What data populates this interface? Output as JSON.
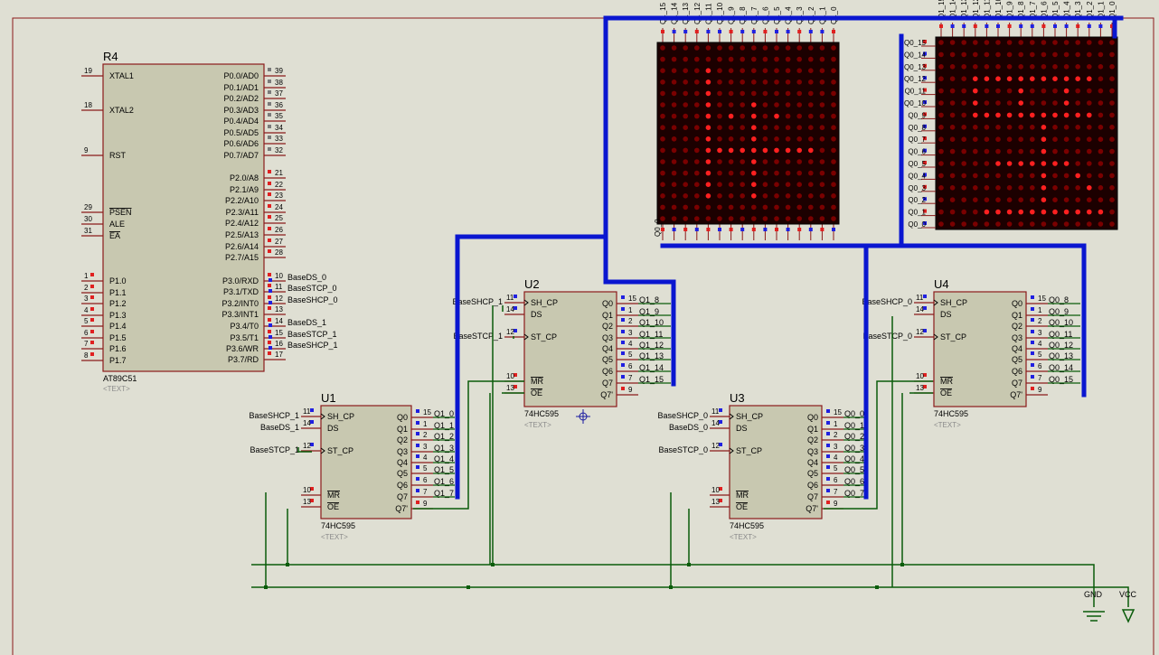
{
  "colors": {
    "background": "#dfdfd3",
    "chip_fill": "#c8c8b0",
    "chip_border": "#8b1a1a",
    "pin_line": "#8b1a1a",
    "wire": "#0a5c0a",
    "bus": "#0a16d0",
    "matrix_bg": "#1c0000",
    "led_on": "#ff2020",
    "led_off": "#7a0000",
    "text": "#000000",
    "placeholder": "#8a8a8a"
  },
  "mcu": {
    "ref": "R4",
    "part": "AT89C51",
    "placeholder": "<TEXT>",
    "left_pins": [
      {
        "num": "19",
        "name": "XTAL1"
      },
      {
        "num": "18",
        "name": "XTAL2"
      },
      {
        "num": "9",
        "name": "RST"
      },
      {
        "num": "29",
        "name": "PSEN"
      },
      {
        "num": "30",
        "name": "ALE"
      },
      {
        "num": "31",
        "name": "EA"
      },
      {
        "num": "1",
        "name": "P1.0"
      },
      {
        "num": "2",
        "name": "P1.1"
      },
      {
        "num": "3",
        "name": "P1.2"
      },
      {
        "num": "4",
        "name": "P1.3"
      },
      {
        "num": "5",
        "name": "P1.4"
      },
      {
        "num": "6",
        "name": "P1.5"
      },
      {
        "num": "7",
        "name": "P1.6"
      },
      {
        "num": "8",
        "name": "P1.7"
      }
    ],
    "right_pins": [
      {
        "num": "39",
        "name": "P0.0/AD0"
      },
      {
        "num": "38",
        "name": "P0.1/AD1"
      },
      {
        "num": "37",
        "name": "P0.2/AD2"
      },
      {
        "num": "36",
        "name": "P0.3/AD3"
      },
      {
        "num": "35",
        "name": "P0.4/AD4"
      },
      {
        "num": "34",
        "name": "P0.5/AD5"
      },
      {
        "num": "33",
        "name": "P0.6/AD6"
      },
      {
        "num": "32",
        "name": "P0.7/AD7"
      },
      {
        "num": "21",
        "name": "P2.0/A8"
      },
      {
        "num": "22",
        "name": "P2.1/A9"
      },
      {
        "num": "23",
        "name": "P2.2/A10"
      },
      {
        "num": "24",
        "name": "P2.3/A11"
      },
      {
        "num": "25",
        "name": "P2.4/A12"
      },
      {
        "num": "26",
        "name": "P2.5/A13"
      },
      {
        "num": "27",
        "name": "P2.6/A14"
      },
      {
        "num": "28",
        "name": "P2.7/A15"
      },
      {
        "num": "10",
        "name": "P3.0/RXD"
      },
      {
        "num": "11",
        "name": "P3.1/TXD"
      },
      {
        "num": "12",
        "name": "P3.2/INT0"
      },
      {
        "num": "13",
        "name": "P3.3/INT1"
      },
      {
        "num": "14",
        "name": "P3.4/T0"
      },
      {
        "num": "15",
        "name": "P3.5/T1"
      },
      {
        "num": "16",
        "name": "P3.6/WR"
      },
      {
        "num": "17",
        "name": "P3.7/RD"
      }
    ],
    "net_labels": [
      "BaseDS_0",
      "BaseSTCP_0",
      "BaseSHCP_0",
      "",
      "BaseDS_1",
      "BaseSTCP_1",
      "BaseSHCP_1",
      ""
    ]
  },
  "shift_register_pins": {
    "left": [
      {
        "num": "11",
        "name": "SH_CP"
      },
      {
        "num": "14",
        "name": "DS"
      },
      {
        "num": "12",
        "name": "ST_CP"
      },
      {
        "num": "10",
        "name": "MR"
      },
      {
        "num": "13",
        "name": "OE"
      }
    ],
    "right_names": [
      "Q0",
      "Q1",
      "Q2",
      "Q3",
      "Q4",
      "Q5",
      "Q6",
      "Q7",
      "Q7'"
    ],
    "right_nums": [
      "15",
      "1",
      "2",
      "3",
      "4",
      "5",
      "6",
      "7",
      "9"
    ]
  },
  "shift_registers": [
    {
      "ref": "U1",
      "part": "74HC595",
      "placeholder": "<TEXT>",
      "in_labels": [
        "BaseSHCP_1",
        "BaseDS_1",
        "BaseSTCP_1"
      ],
      "out_labels": [
        "Q1_0",
        "Q1_1",
        "Q1_2",
        "Q1_3",
        "Q1_4",
        "Q1_5",
        "Q1_6",
        "Q1_7"
      ]
    },
    {
      "ref": "U2",
      "part": "74HC595",
      "placeholder": "<TEXT>",
      "in_labels": [
        "BaseSHCP_1",
        "",
        "BaseSTCP_1"
      ],
      "out_labels": [
        "Q1_8",
        "Q1_9",
        "Q1_10",
        "Q1_11",
        "Q1_12",
        "Q1_13",
        "Q1_14",
        "Q1_15"
      ]
    },
    {
      "ref": "U3",
      "part": "74HC595",
      "placeholder": "<TEXT>",
      "in_labels": [
        "BaseSHCP_0",
        "BaseDS_0",
        "BaseSTCP_0"
      ],
      "out_labels": [
        "Q0_0",
        "Q0_1",
        "Q0_2",
        "Q0_3",
        "Q0_4",
        "Q0_5",
        "Q0_6",
        "Q0_7"
      ]
    },
    {
      "ref": "U4",
      "part": "74HC595",
      "placeholder": "<TEXT>",
      "in_labels": [
        "BaseSHCP_0",
        "",
        "BaseSTCP_0"
      ],
      "out_labels": [
        "Q0_8",
        "Q0_9",
        "Q0_10",
        "Q0_11",
        "Q0_12",
        "Q0_13",
        "Q0_14",
        "Q0_15"
      ]
    }
  ],
  "matrices": [
    {
      "name": "left-matrix",
      "top_labels": [
        "Q1_15",
        "Q1_14",
        "Q1_13",
        "Q1_12",
        "Q1_11",
        "Q1_10",
        "Q1_9",
        "Q1_8",
        "Q1_7",
        "Q1_6",
        "Q1_5",
        "Q1_4",
        "Q1_3",
        "Q1_2",
        "Q1_1",
        "Q1_0"
      ],
      "bottom_labels": [
        "Q0_0"
      ],
      "rows": [
        "0000000000000000",
        "0000000000000000",
        "0000100000000000",
        "0000100000000000",
        "0000100000000000",
        "0000100010000000",
        "0000101010100000",
        "0000100010000000",
        "0000100010000000",
        "0000111111111100",
        "0000100010000000",
        "0000100010000000",
        "0000100010000000",
        "0000100010000000",
        "0000000000000000",
        "0000000000000000"
      ]
    },
    {
      "name": "right-matrix",
      "top_labels": [
        "Q1_15",
        "Q1_14",
        "Q1_13",
        "Q1_12",
        "Q1_11",
        "Q1_10",
        "Q1_9",
        "Q1_8",
        "Q1_7",
        "Q1_6",
        "Q1_5",
        "Q1_4",
        "Q1_3",
        "Q1_2",
        "Q1_1",
        "Q1_0"
      ],
      "left_labels": [
        "Q0_15",
        "Q0_14",
        "Q0_13",
        "Q0_12",
        "Q0_11",
        "Q0_10",
        "Q0_9",
        "Q0_8",
        "Q0_7",
        "Q0_6",
        "Q0_5",
        "Q0_4",
        "Q0_3",
        "Q0_2",
        "Q0_1",
        "Q0_0"
      ],
      "rows": [
        "0000000000000000",
        "0000000000000000",
        "0000000000000000",
        "0001111111111100",
        "0001000100010000",
        "0001000100010000",
        "0001111111111100",
        "0000000001000000",
        "0000000001000000",
        "0000000001000000",
        "0000011111110000",
        "0000000001001000",
        "0000000001000100",
        "0000000001000000",
        "0000111111111110",
        "0000000000000000"
      ]
    }
  ],
  "power": {
    "gnd_label": "GND",
    "vcc_label": "VCC"
  }
}
